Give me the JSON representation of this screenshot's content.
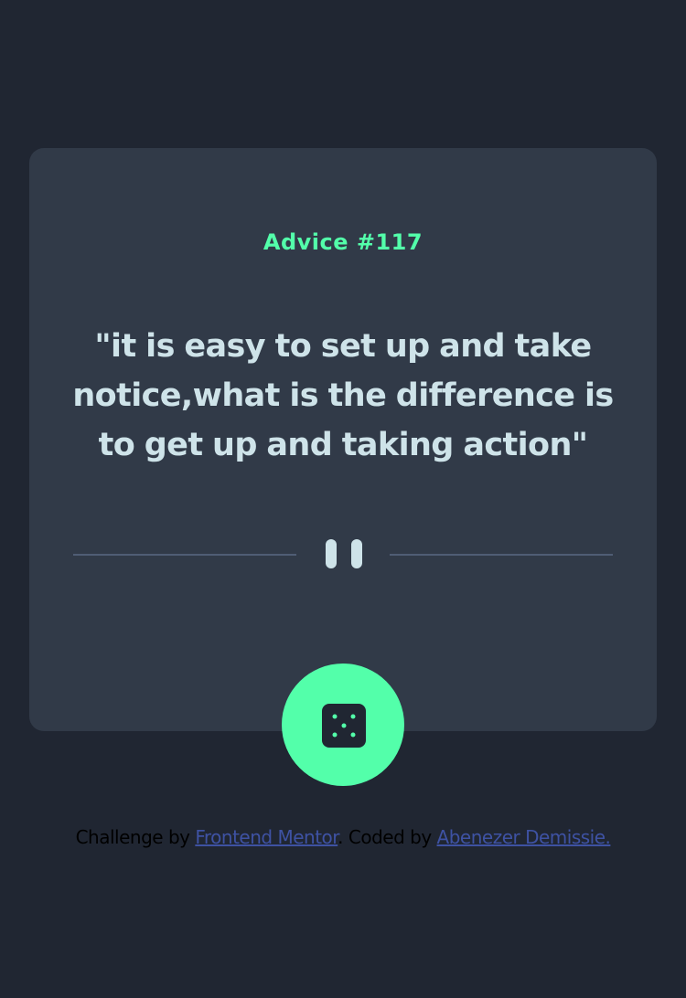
{
  "advice": {
    "id_label": "Advice #117",
    "quote": "\"it is easy to set up and take notice,what is the difference is to get up and taking action\""
  },
  "actions": {
    "dice_icon": "dice-icon",
    "pause_icon": "pause-icon"
  },
  "attribution": {
    "prefix": "Challenge by",
    "challenge_link": "Frontend Mentor",
    "middle": ". Coded by",
    "author_link": "Abenezer Demissie."
  },
  "colors": {
    "background": "#202632",
    "card": "#313a48",
    "accent": "#53ffaa",
    "quote_text": "#cee3e9",
    "divider": "#4f5d74",
    "link": "#3e52a3"
  }
}
